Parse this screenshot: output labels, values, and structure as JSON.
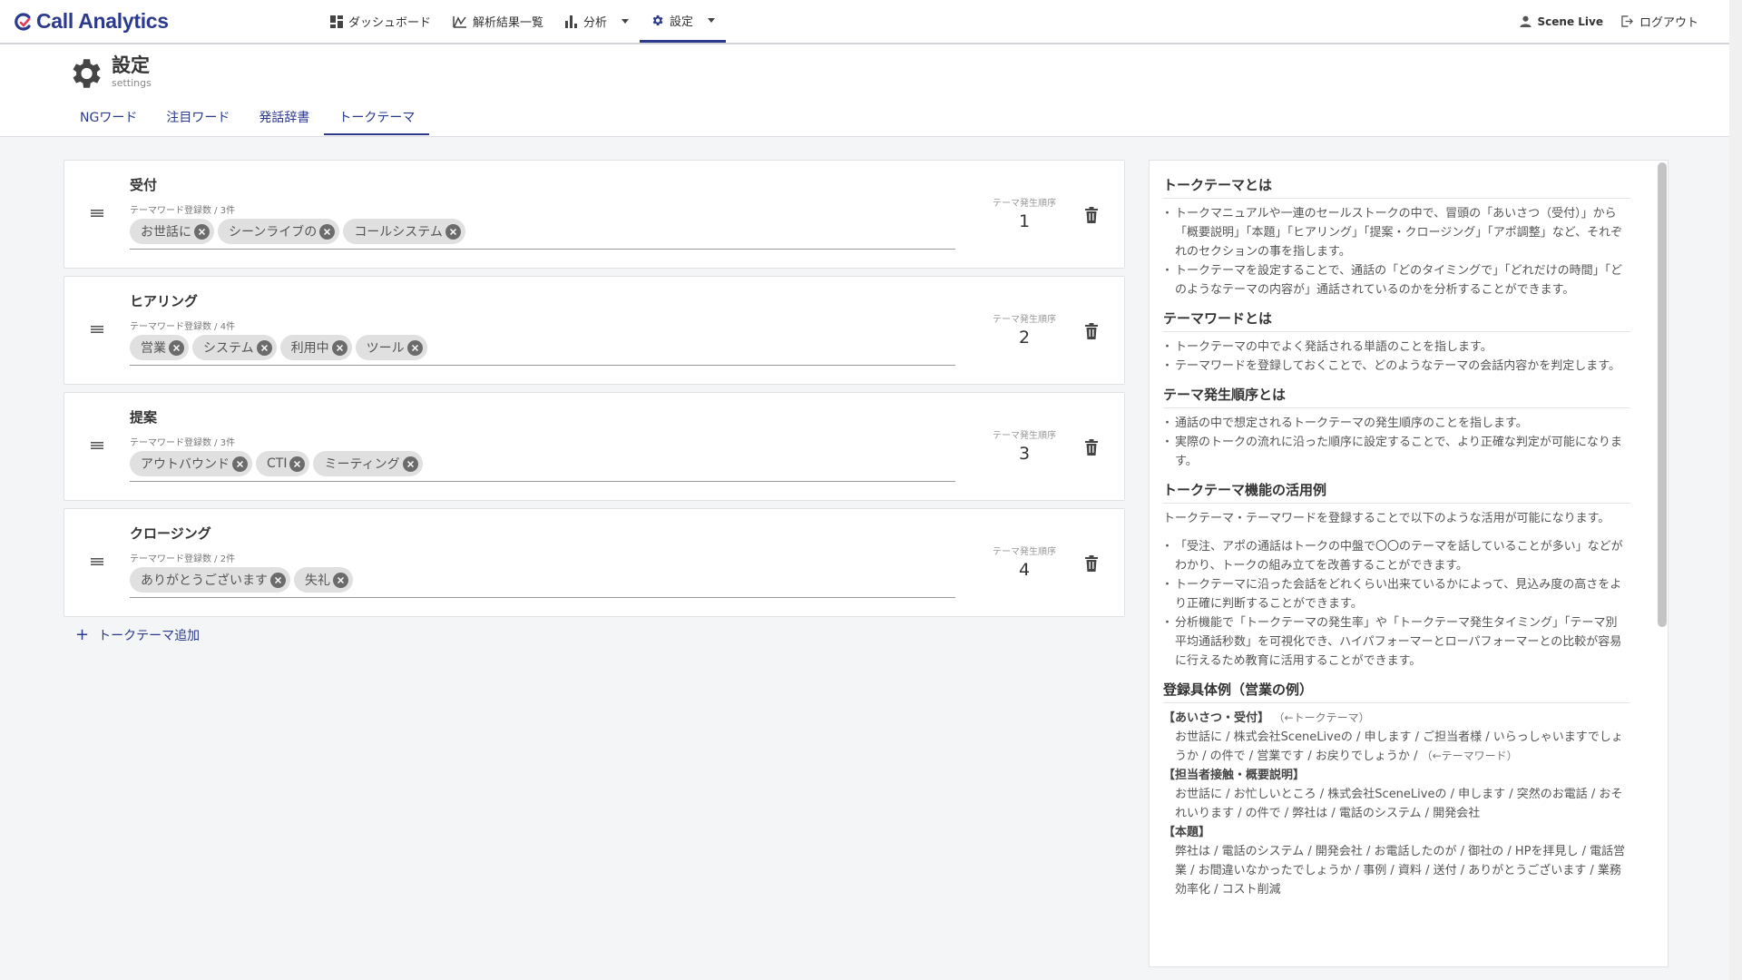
{
  "navbar": {
    "logo_text": "Call Analytics",
    "items": [
      {
        "label": "ダッシュボード",
        "icon": "dashboard-icon"
      },
      {
        "label": "解析結果一覧",
        "icon": "chart-line-icon"
      },
      {
        "label": "分析",
        "icon": "bar-chart-icon"
      },
      {
        "label": "設定",
        "icon": "gear-icon"
      }
    ],
    "user": "Scene Live",
    "logout": "ログアウト"
  },
  "page": {
    "title": "設定",
    "subtitle": "settings",
    "tabs": [
      "NGワード",
      "注目ワード",
      "発話辞書",
      "トークテーマ"
    ],
    "active_tab": "トークテーマ"
  },
  "themes": [
    {
      "name": "受付",
      "count_label": "テーマワード登録数 / 3件",
      "words": [
        "お世話に",
        "シーンライブの",
        "コールシステム"
      ],
      "order_label": "テーマ発生順序",
      "order": "1"
    },
    {
      "name": "ヒアリング",
      "count_label": "テーマワード登録数 / 4件",
      "words": [
        "営業",
        "システム",
        "利用中",
        "ツール"
      ],
      "order_label": "テーマ発生順序",
      "order": "2"
    },
    {
      "name": "提案",
      "count_label": "テーマワード登録数 / 3件",
      "words": [
        "アウトバウンド",
        "CTI",
        "ミーティング"
      ],
      "order_label": "テーマ発生順序",
      "order": "3"
    },
    {
      "name": "クロージング",
      "count_label": "テーマワード登録数 / 2件",
      "words": [
        "ありがとうございます",
        "失礼"
      ],
      "order_label": "テーマ発生順序",
      "order": "4"
    }
  ],
  "add_theme_label": "トークテーマ追加",
  "help": {
    "s1_title": "トークテーマとは",
    "s1_items": [
      "トークマニュアルや一連のセールストークの中で、冒頭の「あいさつ（受付）」から「概要説明」「本題」「ヒアリング」「提案・クロージング」「アポ調整」など、それぞれのセクションの事を指します。",
      "トークテーマを設定することで、通話の「どのタイミングで」「どれだけの時間」「どのようなテーマの内容が」通話されているのかを分析することができます。"
    ],
    "s2_title": "テーマワードとは",
    "s2_items": [
      "トークテーマの中でよく発話される単語のことを指します。",
      "テーマワードを登録しておくことで、どのようなテーマの会話内容かを判定します。"
    ],
    "s3_title": "テーマ発生順序とは",
    "s3_items": [
      "通話の中で想定されるトークテーマの発生順序のことを指します。",
      "実際のトークの流れに沿った順序に設定することで、より正確な判定が可能になります。"
    ],
    "s4_title": "トークテーマ機能の活用例",
    "s4_intro": "トークテーマ・テーマワードを登録することで以下のような活用が可能になります。",
    "s4_items": [
      "「受注、アポの通話はトークの中盤で〇〇のテーマを話していることが多い」などがわかり、トークの組み立てを改善することができます。",
      "トークテーマに沿った会話をどれくらい出来ているかによって、見込み度の高さをより正確に判断することができます。",
      "分析機能で「トークテーマの発生率」や「トークテーマ発生タイミング」「テーマ別 平均通話秒数」を可視化でき、ハイパフォーマーとローパフォーマーとの比較が容易に行えるため教育に活用することができます。"
    ],
    "s5_title": "登録具体例（営業の例）",
    "ex1_head": "【あいさつ・受付】",
    "ex1_note": "（←トークテーマ）",
    "ex1_body": "お世話に / 株式会社SceneLiveの / 申します / ご担当者様 / いらっしゃいますでしょうか / の件で / 営業です / お戻りでしょうか / ",
    "ex1_body_note": "（←テーマワード）",
    "ex2_head": "【担当者接触・概要説明】",
    "ex2_body": "お世話に / お忙しいところ / 株式会社SceneLiveの / 申します / 突然のお電話 / おそれいります / の件で / 弊社は / 電話のシステム / 開発会社",
    "ex3_head": "【本題】",
    "ex3_body": "弊社は / 電話のシステム / 開発会社 / お電話したのが / 御社の / HPを拝見し / 電話営業 / お間違いなかったでしょうか / 事例 / 資料 / 送付 / ありがとうございます / 業務効率化 / コスト削減"
  }
}
